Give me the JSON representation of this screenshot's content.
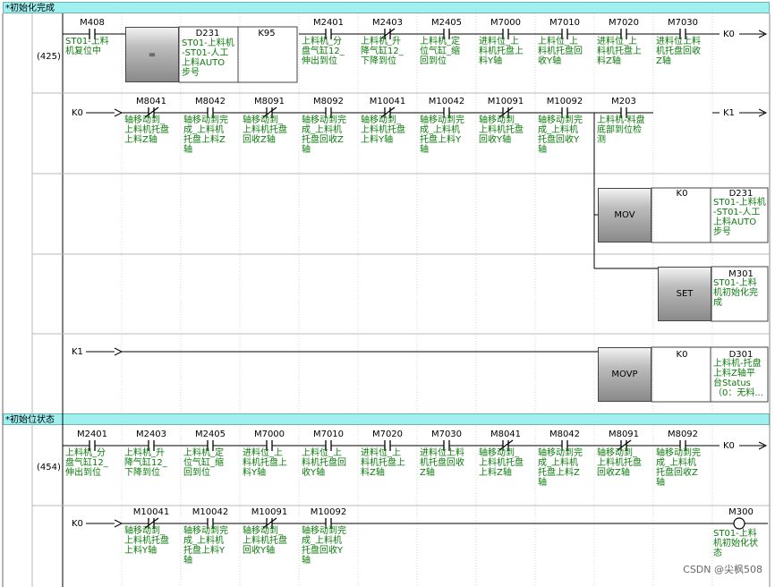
{
  "section1": {
    "header": "*初始化完成",
    "step": "(425)",
    "rung1": {
      "contacts": [
        {
          "dev": "M408",
          "cmt": [
            "ST01-上料",
            "机复位中"
          ],
          "nc": false
        },
        {
          "dev": "M2401",
          "cmt": [
            "上料机_分",
            "盘气缸12_",
            "伸出到位"
          ],
          "nc": false
        },
        {
          "dev": "M2403",
          "cmt": [
            "上料机_升",
            "降气缸12_",
            "下降到位"
          ],
          "nc": true
        },
        {
          "dev": "M2405",
          "cmt": [
            "上料机_定",
            "位气缸_缩",
            "回到位"
          ],
          "nc": false
        },
        {
          "dev": "M7000",
          "cmt": [
            "进料位_上",
            "料机托盘上",
            "料Y轴"
          ],
          "nc": false
        },
        {
          "dev": "M7010",
          "cmt": [
            "上料位_上",
            "料机托盘回",
            "收Y轴"
          ],
          "nc": false
        },
        {
          "dev": "M7020",
          "cmt": [
            "进料位_上",
            "料机托盘上",
            "料Z轴"
          ],
          "nc": false
        },
        {
          "dev": "M7030",
          "cmt": [
            "进料位上料",
            "机托盘回收",
            "Z轴"
          ],
          "nc": false
        }
      ],
      "compare": {
        "op": "=",
        "d": "D231",
        "dcmt": [
          "ST01-上料机",
          "-ST01-人工",
          "上料AUTO",
          "步号"
        ],
        "k": "K95"
      },
      "out": "K0"
    },
    "rung2": {
      "in": "K0",
      "contacts": [
        {
          "dev": "M8041",
          "cmt": [
            "轴移动到_",
            "上料机托盘",
            "上料Z轴"
          ],
          "nc": true
        },
        {
          "dev": "M8042",
          "cmt": [
            "轴移动到完",
            "成_上料机",
            "托盘上料Z",
            "轴"
          ],
          "nc": false
        },
        {
          "dev": "M8091",
          "cmt": [
            "轴移动到_",
            "上料机托盘",
            "回收Z轴"
          ],
          "nc": true
        },
        {
          "dev": "M8092",
          "cmt": [
            "轴移动到完",
            "成_上料机",
            "托盘回收Z",
            "轴"
          ],
          "nc": false
        },
        {
          "dev": "M10041",
          "cmt": [
            "轴移动到_",
            "上料机托盘",
            "上料Y轴"
          ],
          "nc": true
        },
        {
          "dev": "M10042",
          "cmt": [
            "轴移动到完",
            "成_上料机",
            "托盘上料Y",
            "轴"
          ],
          "nc": false
        },
        {
          "dev": "M10091",
          "cmt": [
            "轴移动到_",
            "上料机托盘",
            "回收Y轴"
          ],
          "nc": true
        },
        {
          "dev": "M10092",
          "cmt": [
            "轴移动到完",
            "成_上料机",
            "托盘回收Y",
            "轴"
          ],
          "nc": false
        },
        {
          "dev": "M203",
          "cmt": [
            "上料机-料盘",
            "底部到位检",
            "测"
          ],
          "nc": false
        }
      ],
      "out": "K1"
    },
    "mov": {
      "op": "MOV",
      "src": "K0",
      "dst": "D231",
      "dcmt": [
        "ST01-上料机",
        "-ST01-人工",
        "上料AUTO",
        "步号"
      ]
    },
    "set": {
      "op": "SET",
      "dst": "M301",
      "dcmt": [
        "ST01-上料",
        "机初始化完",
        "成"
      ]
    },
    "movp": {
      "in": "K1",
      "op": "MOVP",
      "src": "K0",
      "dst": "D301",
      "dcmt": [
        "上料机-托盘",
        "上料Z轴平",
        "台Status",
        "（0：无料..."
      ]
    }
  },
  "section2": {
    "header": "*初始位状态",
    "step": "(454)",
    "rung1": {
      "contacts": [
        {
          "dev": "M2401",
          "cmt": [
            "上料机_分",
            "盘气缸12_",
            "伸出到位"
          ],
          "nc": false
        },
        {
          "dev": "M2403",
          "cmt": [
            "上料机_升",
            "降气缸12_",
            "下降到位"
          ],
          "nc": false
        },
        {
          "dev": "M2405",
          "cmt": [
            "上料机_定",
            "位气缸_缩",
            "回到位"
          ],
          "nc": false
        },
        {
          "dev": "M7000",
          "cmt": [
            "进料位_上",
            "料机托盘上",
            "料Y轴"
          ],
          "nc": false
        },
        {
          "dev": "M7010",
          "cmt": [
            "上料位_上",
            "料机托盘回",
            "收Y轴"
          ],
          "nc": false
        },
        {
          "dev": "M7020",
          "cmt": [
            "进料位_上",
            "料机托盘上",
            "料Z轴"
          ],
          "nc": false
        },
        {
          "dev": "M7030",
          "cmt": [
            "进料位上料",
            "机托盘回收",
            "Z轴"
          ],
          "nc": false
        },
        {
          "dev": "M8041",
          "cmt": [
            "轴移动到_",
            "上料机托盘",
            "上料Z轴"
          ],
          "nc": true
        },
        {
          "dev": "M8042",
          "cmt": [
            "轴移动到完",
            "成_上料机",
            "托盘上料Z",
            "轴"
          ],
          "nc": false
        },
        {
          "dev": "M8091",
          "cmt": [
            "轴移动到_",
            "上料机托盘",
            "回收Z轴"
          ],
          "nc": true
        },
        {
          "dev": "M8092",
          "cmt": [
            "轴移动到完",
            "成_上料机",
            "托盘回收Z",
            "轴"
          ],
          "nc": false
        }
      ],
      "out": "K0"
    },
    "rung2": {
      "in": "K0",
      "contacts": [
        {
          "dev": "M10041",
          "cmt": [
            "轴移动到_",
            "上料机托盘",
            "上料Y轴"
          ],
          "nc": true
        },
        {
          "dev": "M10042",
          "cmt": [
            "轴移动到完",
            "成_上料机",
            "托盘上料Y",
            "轴"
          ],
          "nc": false
        },
        {
          "dev": "M10091",
          "cmt": [
            "轴移动到_",
            "上料机托盘",
            "回收Y轴"
          ],
          "nc": true
        },
        {
          "dev": "M10092",
          "cmt": [
            "轴移动到完",
            "成_上料机",
            "托盘回收Y",
            "轴"
          ],
          "nc": false
        }
      ],
      "coil": {
        "dev": "M300",
        "cmt": [
          "ST01-上料",
          "机初始化状",
          "态"
        ]
      }
    }
  },
  "watermark": "CSDN @尖枫508"
}
